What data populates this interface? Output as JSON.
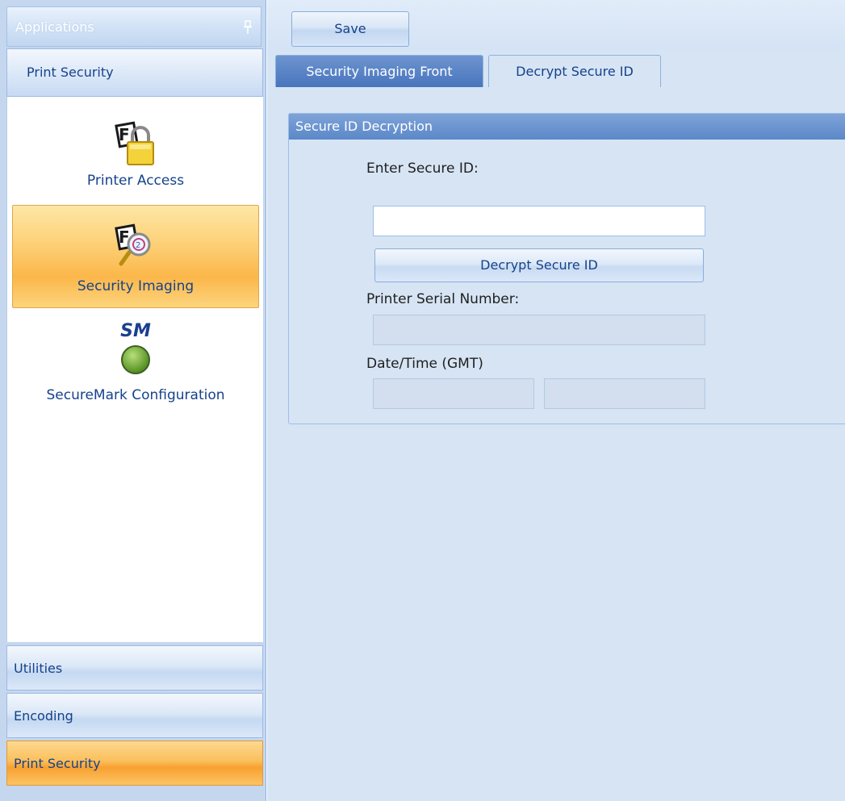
{
  "sidebar": {
    "header_title": "Applications",
    "section_title": "Print Security",
    "items": [
      {
        "label": "Printer Access",
        "icon": "padlock-icon"
      },
      {
        "label": "Security Imaging",
        "icon": "magnifier-icon",
        "selected": true
      },
      {
        "label": "SecureMark Configuration",
        "icon": "green-circle-icon",
        "badge": "SM"
      }
    ],
    "nav": [
      {
        "label": "Utilities"
      },
      {
        "label": "Encoding"
      },
      {
        "label": "Print Security",
        "active": true
      }
    ]
  },
  "toolbar": {
    "save_label": "Save"
  },
  "tabs": [
    {
      "label": "Security Imaging Front",
      "active": false
    },
    {
      "label": "Decrypt Secure ID",
      "active": true
    }
  ],
  "group": {
    "title": "Secure ID Decryption",
    "enter_label": "Enter Secure ID:",
    "secure_id_value": "",
    "decrypt_label": "Decrypt Secure ID",
    "serial_label": "Printer Serial Number:",
    "serial_value": "",
    "datetime_label": "Date/Time (GMT)",
    "date_value": "",
    "time_value": ""
  },
  "colors": {
    "accent_orange": "#fbb74a",
    "panel_blue": "#d6e4f4",
    "header_blue": "#5b88c8",
    "text_blue": "#15428b"
  }
}
